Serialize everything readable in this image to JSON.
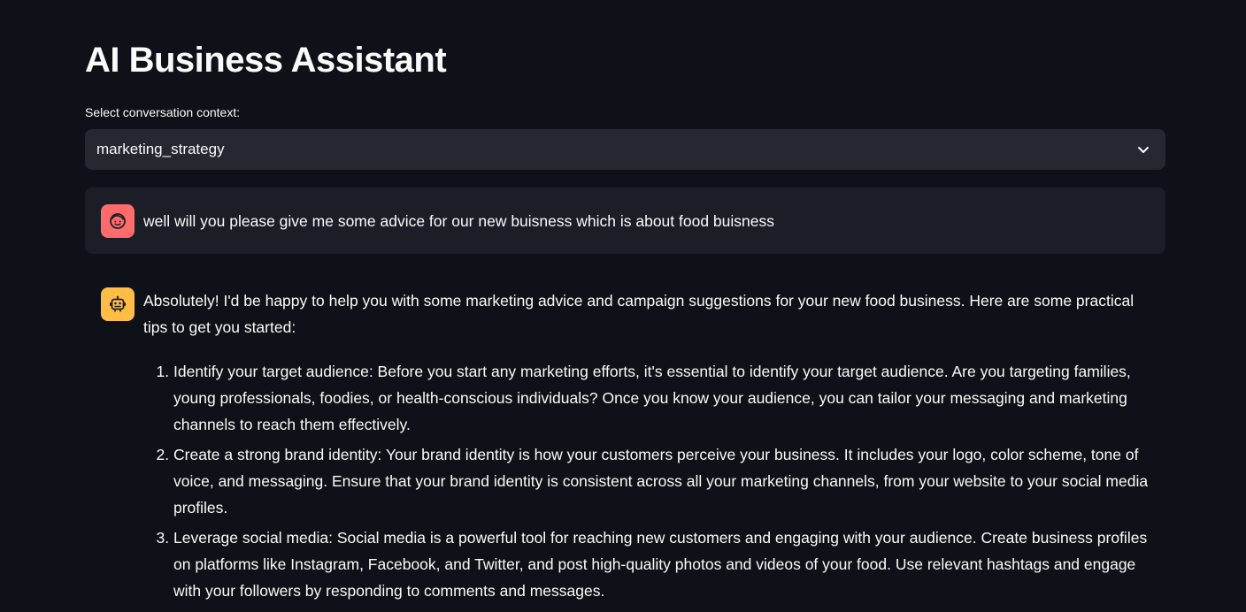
{
  "app": {
    "title": "AI Business Assistant"
  },
  "context_select": {
    "label": "Select conversation context:",
    "value": "marketing_strategy"
  },
  "messages": {
    "user": {
      "avatar_icon": "smiling-face-icon",
      "avatar_color": "#ff6b6b",
      "text": "well will you please give me some advice for our new buisness which is about food buisness"
    },
    "assistant": {
      "avatar_icon": "robot-icon",
      "avatar_color": "#ffbd45",
      "intro": "Absolutely! I'd be happy to help you with some marketing advice and campaign suggestions for your new food business. Here are some practical tips to get you started:",
      "tips": [
        "Identify your target audience: Before you start any marketing efforts, it's essential to identify your target audience. Are you targeting families, young professionals, foodies, or health-conscious individuals? Once you know your audience, you can tailor your messaging and marketing channels to reach them effectively.",
        "Create a strong brand identity: Your brand identity is how your customers perceive your business. It includes your logo, color scheme, tone of voice, and messaging. Ensure that your brand identity is consistent across all your marketing channels, from your website to your social media profiles.",
        "Leverage social media: Social media is a powerful tool for reaching new customers and engaging with your audience. Create business profiles on platforms like Instagram, Facebook, and Twitter, and post high-quality photos and videos of your food. Use relevant hashtags and engage with your followers by responding to comments and messages."
      ]
    }
  },
  "theme": {
    "background": "#0e1117",
    "input_background": "#262730",
    "user_message_background": "#1b1e26"
  }
}
